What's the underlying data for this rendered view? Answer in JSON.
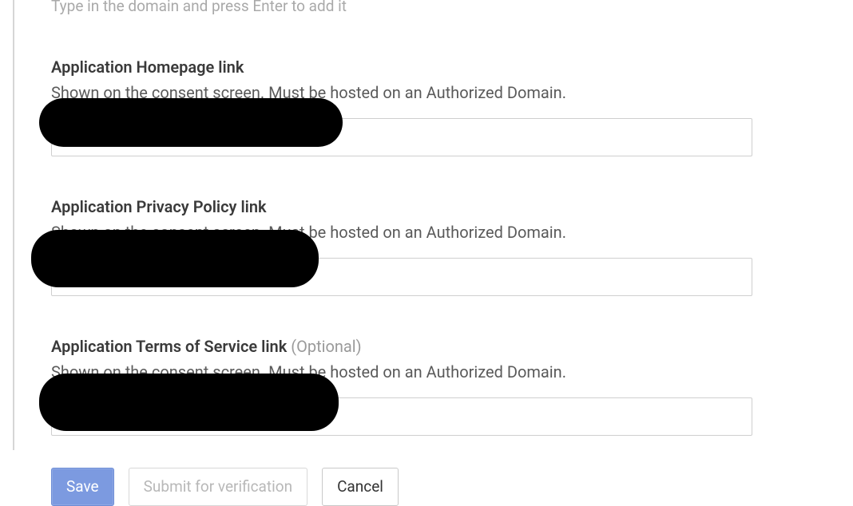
{
  "topHint": "Type in the domain and press Enter to add it",
  "homepage": {
    "label": "Application Homepage link",
    "desc": "Shown on the consent screen. Must be hosted on an Authorized Domain.",
    "value": ""
  },
  "privacy": {
    "label": "Application Privacy Policy link",
    "desc": "Shown on the consent screen. Must be hosted on an Authorized Domain.",
    "value": ""
  },
  "tos": {
    "label": "Application Terms of Service link ",
    "optional": "(Optional)",
    "desc": "Shown on the consent screen. Must be hosted on an Authorized Domain.",
    "value": ""
  },
  "buttons": {
    "save": "Save",
    "submit": "Submit for verification",
    "cancel": "Cancel"
  }
}
